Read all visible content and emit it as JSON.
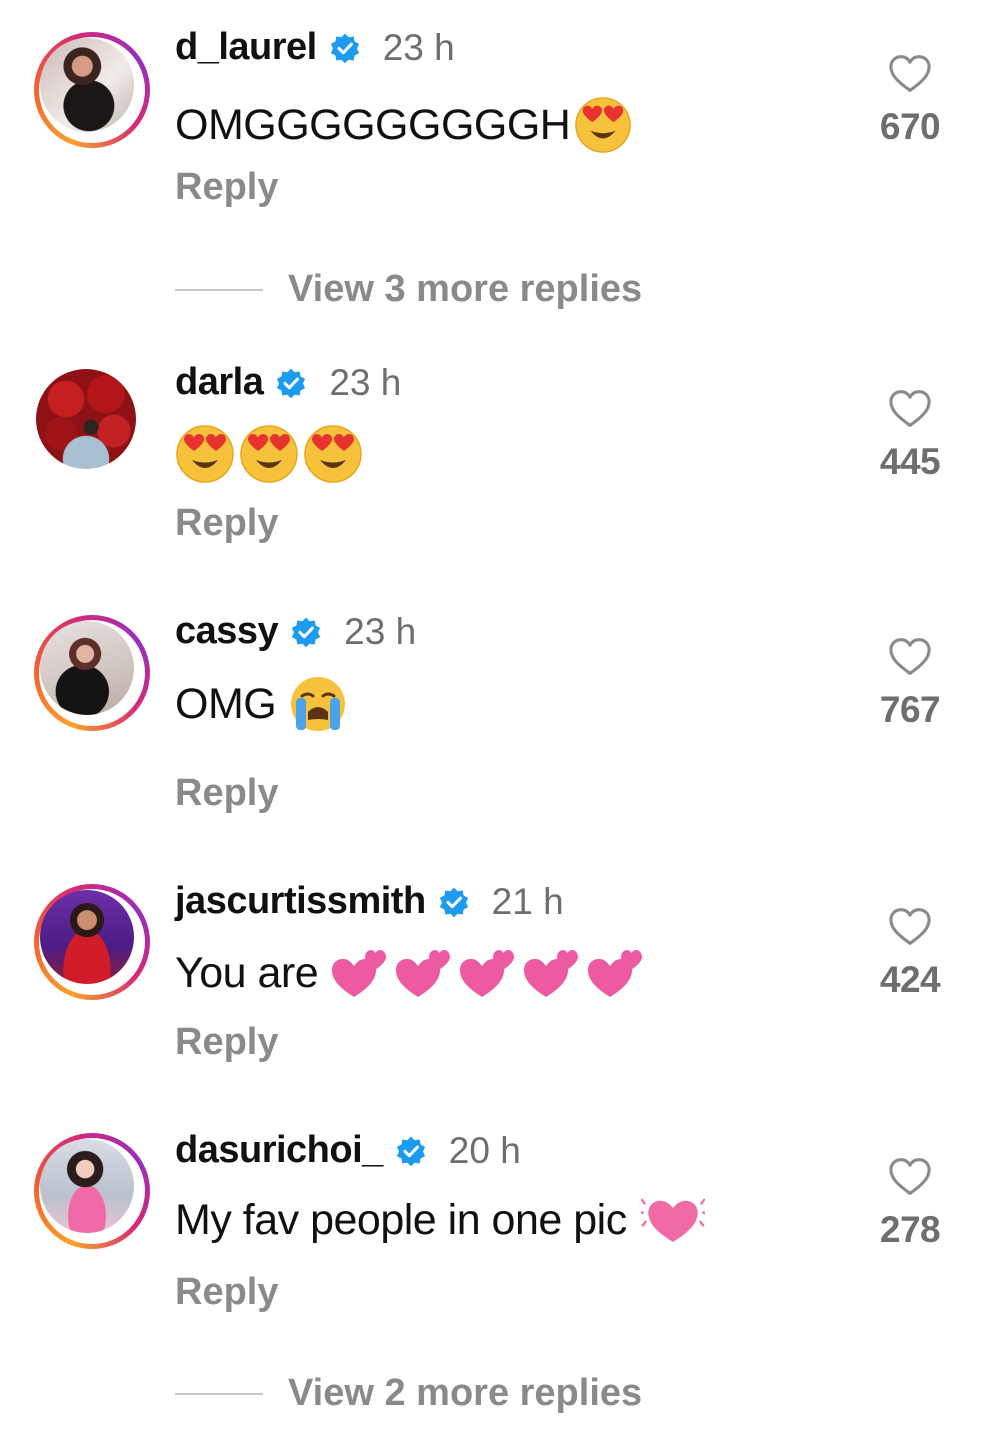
{
  "comments": [
    {
      "username": "d_laurel",
      "time": "23 h",
      "text": "OMGGGGGGGGGH",
      "emojis": "heart-eyes",
      "reply": "Reply",
      "likes": "670",
      "view_more": "View 3 more replies"
    },
    {
      "username": "darla",
      "time": "23 h",
      "text": "",
      "emojis": "heart-eyes x3",
      "reply": "Reply",
      "likes": "445"
    },
    {
      "username": "cassy",
      "time": "23 h",
      "text": "OMG",
      "emojis": "crying-face",
      "reply": "Reply",
      "likes": "767"
    },
    {
      "username": "jascurtissmith",
      "time": "21 h",
      "text": "You are",
      "emojis": "two-hearts x5",
      "reply": "Reply",
      "likes": "424"
    },
    {
      "username": "dasurichoi_",
      "time": "20 h",
      "text": "My fav people in one pic",
      "emojis": "beating-heart",
      "reply": "Reply",
      "likes": "278",
      "view_more": "View 2 more replies"
    }
  ],
  "colors": {
    "verified": "#1d9bf0",
    "muted_text": "#8a8a8a",
    "ring_start": "#f9a12b",
    "ring_end": "#d62976"
  },
  "icons": {
    "verified": "verified-badge-icon",
    "like": "heart-outline-icon"
  }
}
